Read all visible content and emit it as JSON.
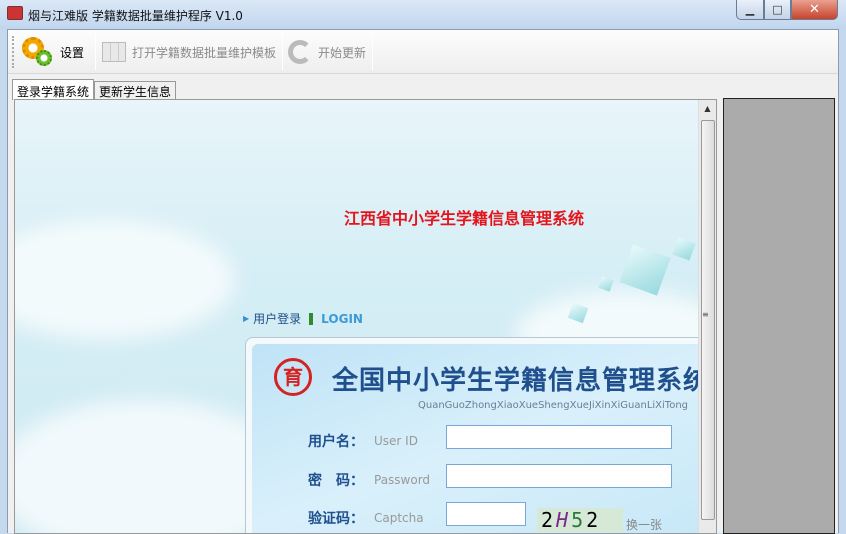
{
  "window": {
    "title": "烟与江难版 学籍数据批量维护程序 V1.0",
    "minimize": "▁",
    "maximize": "□",
    "close": "✕"
  },
  "toolbar": {
    "settings": "设置",
    "open_template": "打开学籍数据批量维护模板",
    "start_update": "开始更新"
  },
  "tabs": [
    {
      "label": "登录学籍系统",
      "active": true
    },
    {
      "label": "更新学生信息",
      "active": false
    }
  ],
  "page": {
    "heading": "江西省中小学生学籍信息管理系统",
    "login_label": "用户登录",
    "login_en": "LOGIN",
    "logo_text": "育",
    "system_title": "全国中小学生学籍信息管理系统",
    "pinyin": "QuanGuoZhongXiaoXueShengXueJiXinXiGuanLiXiTong",
    "fields": [
      {
        "label": "用户名：",
        "en": "User ID",
        "value": ""
      },
      {
        "label": "密　码：",
        "en": "Password",
        "value": ""
      },
      {
        "label": "验证码：",
        "en": "Captcha",
        "value": ""
      }
    ],
    "captcha": {
      "c1": "2",
      "c2": "H",
      "c3": "5",
      "c4": "2"
    },
    "refresh_captcha": "换一张"
  },
  "colors": {
    "heading": "#e4141c",
    "title_blue": "#1f4f8c"
  }
}
